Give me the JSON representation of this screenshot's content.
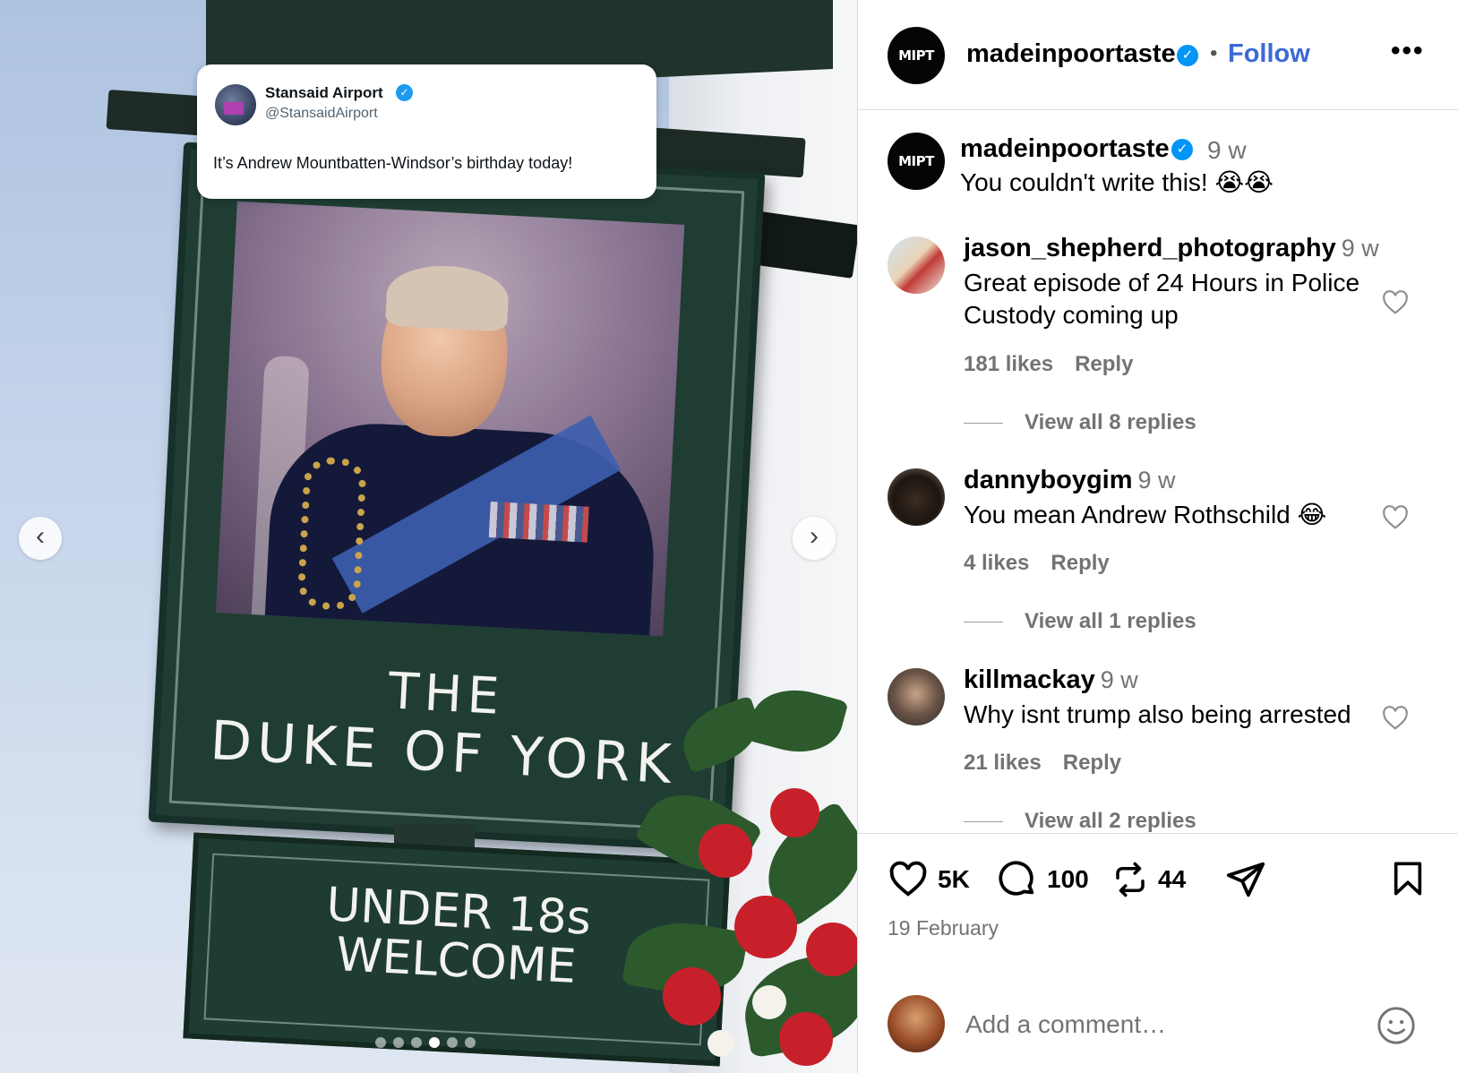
{
  "post_image": {
    "tweet": {
      "name": "Stansaid Airport",
      "handle": "@StansaidAirport",
      "text": "It’s Andrew Mountbatten-Windsor’s birthday today!"
    },
    "sign_line1": "THE",
    "sign_line2": "DUKE OF YORK",
    "subsign_line1": "UNDER 18s",
    "subsign_line2": "WELCOME",
    "carousel": {
      "total": 6,
      "active": 3
    }
  },
  "header": {
    "logo_text": "MIPT",
    "username": "madeinpoortaste",
    "separator": "•",
    "follow_label": "Follow",
    "more_label": "•••"
  },
  "caption": {
    "username": "madeinpoortaste",
    "time": "9 w",
    "text": "You couldn't write this! 😭😭"
  },
  "comments": [
    {
      "username": "jason_shepherd_photography",
      "time": "9 w",
      "text": "Great episode of 24 Hours in Police Custody coming up",
      "likes": "181 likes",
      "reply_label": "Reply",
      "view_replies": "View all 8 replies"
    },
    {
      "username": "dannyboygim",
      "time": "9 w",
      "text": "You mean Andrew Rothschild 😂",
      "likes": "4 likes",
      "reply_label": "Reply",
      "view_replies": "View all 1 replies"
    },
    {
      "username": "killmackay",
      "time": "9 w",
      "text": "Why isnt trump also being arrested",
      "likes": "21 likes",
      "reply_label": "Reply",
      "view_replies": "View all 2 replies"
    }
  ],
  "actions": {
    "likes": "5K",
    "comments": "100",
    "reposts": "44",
    "date": "19 February"
  },
  "add_comment": {
    "placeholder": "Add a comment…"
  },
  "colors": {
    "follow": "#3b6ad6",
    "verified": "#0095f6",
    "muted_text": "#737373"
  }
}
